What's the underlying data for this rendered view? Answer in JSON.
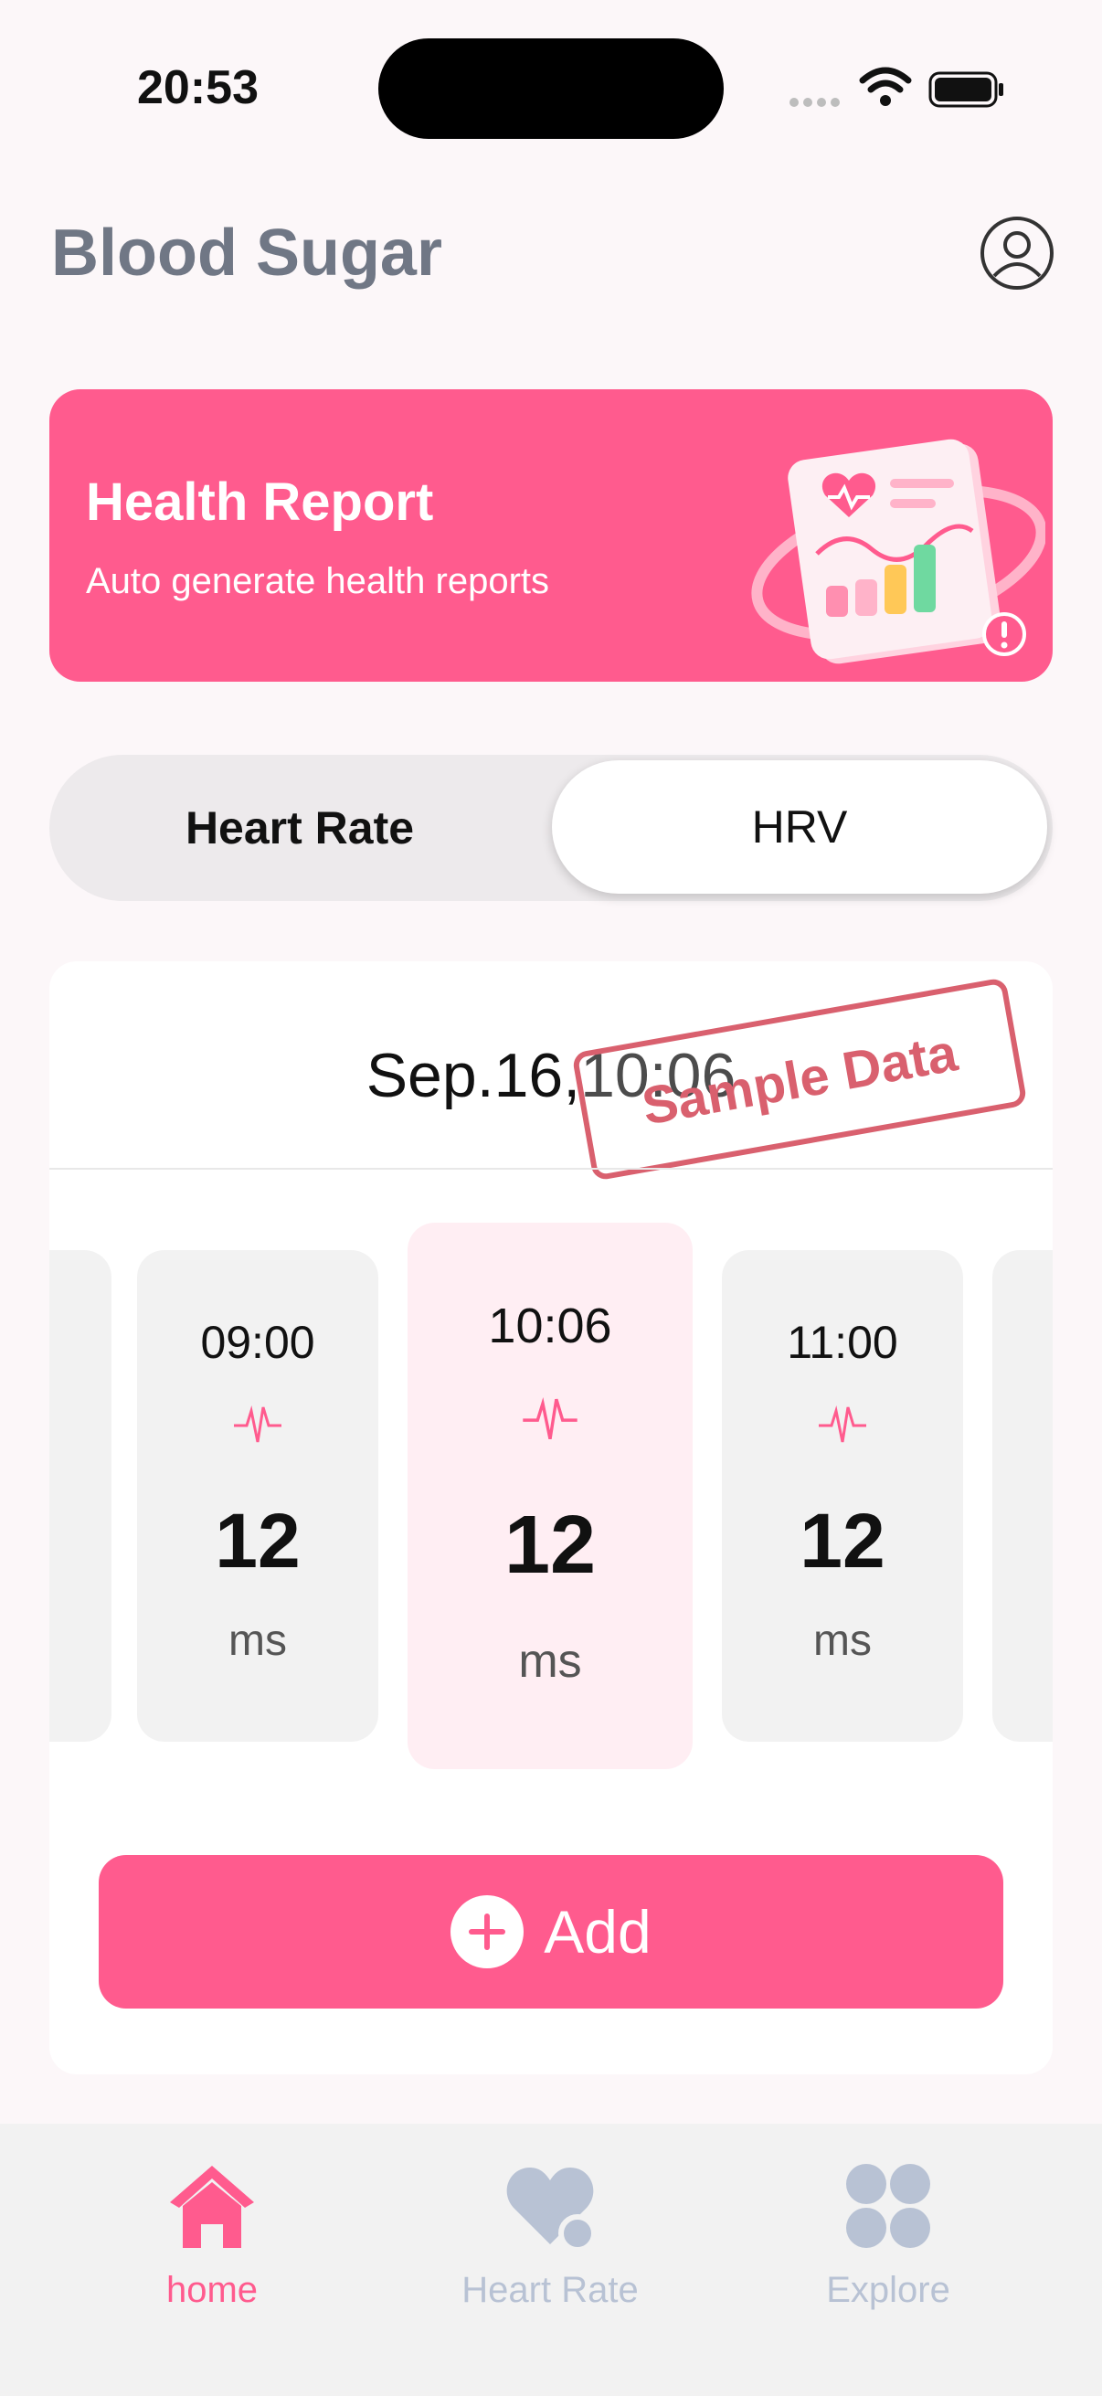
{
  "status_bar": {
    "time": "20:53"
  },
  "header": {
    "title": "Blood Sugar"
  },
  "banner": {
    "title": "Health Report",
    "subtitle": "Auto generate health reports",
    "accent_color": "#FF5B8E"
  },
  "segmented": {
    "options": [
      "Heart Rate",
      "HRV"
    ],
    "selected": "HRV"
  },
  "card": {
    "date": "Sep.16,10:06",
    "stamp": "Sample Data",
    "readings": [
      {
        "time": "09:00",
        "value": "12",
        "unit": "ms"
      },
      {
        "time": "10:06",
        "value": "12",
        "unit": "ms"
      },
      {
        "time": "11:00",
        "value": "12",
        "unit": "ms"
      }
    ],
    "add_label": "Add"
  },
  "tabbar": {
    "items": [
      {
        "label": "home",
        "icon": "home-icon",
        "active": true
      },
      {
        "label": "Heart Rate",
        "icon": "heart-icon",
        "active": false
      },
      {
        "label": "Explore",
        "icon": "grid-icon",
        "active": false
      }
    ]
  }
}
